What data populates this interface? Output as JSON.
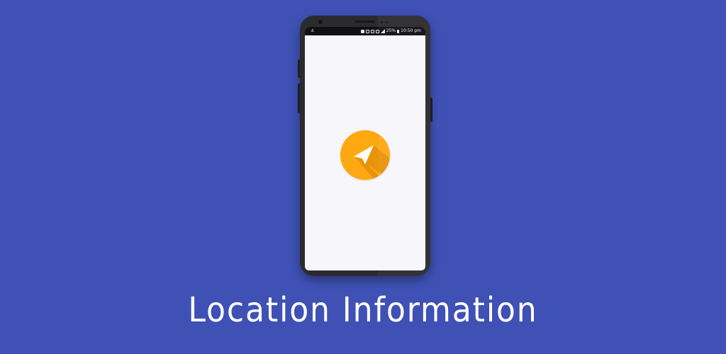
{
  "colors": {
    "background": "#3f51b5",
    "phone_body": "#2b2b2f",
    "screen": "#f7f7fb",
    "accent_orange": "#ffa812",
    "text": "#ffffff"
  },
  "statusbar": {
    "left_icon": "anchor-icon",
    "battery": "25%",
    "time": "10:50 pm"
  },
  "app": {
    "icon": "navigation-arrow-icon"
  },
  "caption": {
    "title": "Location Information"
  }
}
